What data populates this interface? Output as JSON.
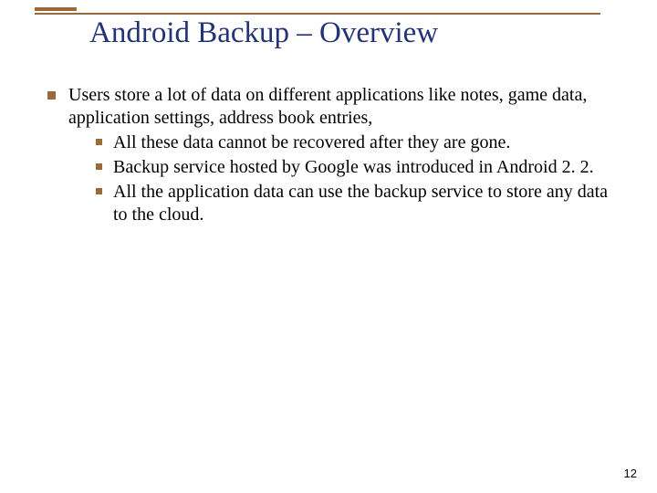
{
  "title": "Android Backup – Overview",
  "body": {
    "l1_text": "Users store a lot of data on different applications like notes, game data, application settings, address book entries,",
    "l2": [
      "All these data cannot be recovered after they are gone.",
      "Backup service hosted by Google was introduced in Android 2. 2.",
      "All the application data can use the backup service to store any data to the cloud."
    ]
  },
  "page_number": "12",
  "colors": {
    "accent": "#9a6a3a",
    "title": "#223377"
  }
}
